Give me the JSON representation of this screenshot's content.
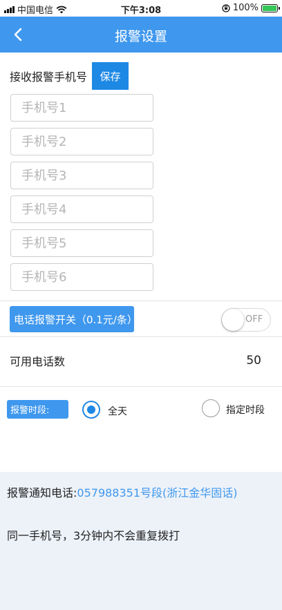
{
  "status_bar": {
    "carrier": "中国电信",
    "time": "下午3:08",
    "battery": "100%",
    "icons": [
      "signal-icon",
      "wifi-icon",
      "orientation-lock-icon",
      "battery-charging-icon"
    ]
  },
  "nav": {
    "back_icon": "back-chevron-icon",
    "title": "报警设置"
  },
  "receiver": {
    "label": "接收报警手机号",
    "save_label": "保存",
    "phones": [
      {
        "value": "",
        "placeholder": "手机号1"
      },
      {
        "value": "",
        "placeholder": "手机号2"
      },
      {
        "value": "",
        "placeholder": "手机号3"
      },
      {
        "value": "",
        "placeholder": "手机号4"
      },
      {
        "value": "",
        "placeholder": "手机号5"
      },
      {
        "value": "",
        "placeholder": "手机号6"
      }
    ]
  },
  "call_alarm": {
    "label": "电话报警开关（0.1元/条）",
    "toggle_text": "OFF",
    "enabled": false
  },
  "available_calls": {
    "label": "可用电话数",
    "value": "50"
  },
  "period": {
    "label": "报警时段:",
    "options": [
      {
        "label": "全天",
        "checked": true
      },
      {
        "label": "指定时段",
        "checked": false
      }
    ]
  },
  "footer": {
    "notice_prefix": "报警通知电话:",
    "notice_number": "057988351号段(浙江金华固话)",
    "repeat_note": "同一手机号，3分钟内不会重复拨打"
  },
  "colors": {
    "accent": "#3f98ee",
    "button": "#1e88e5",
    "footer_bg": "#edf2f9"
  }
}
